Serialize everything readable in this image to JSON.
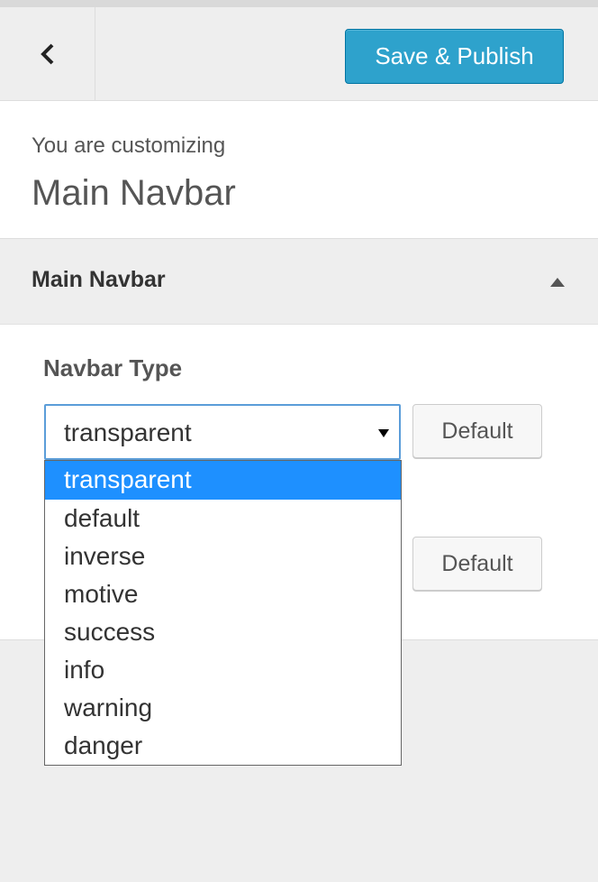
{
  "header": {
    "back_icon": "chevron-left-icon",
    "save_label": "Save & Publish"
  },
  "info": {
    "pre_title": "You are customizing",
    "title": "Main Navbar"
  },
  "section": {
    "title": "Main Navbar",
    "toggle_icon": "triangle-up-icon"
  },
  "control": {
    "label": "Navbar Type",
    "selected_value": "transparent",
    "default_label": "Default",
    "default_label_2": "Default",
    "options": [
      "transparent",
      "default",
      "inverse",
      "motive",
      "success",
      "info",
      "warning",
      "danger"
    ]
  },
  "colors": {
    "primary": "#2ea2cc",
    "selection": "#1e90ff",
    "focus_border": "#5b9dd9"
  }
}
